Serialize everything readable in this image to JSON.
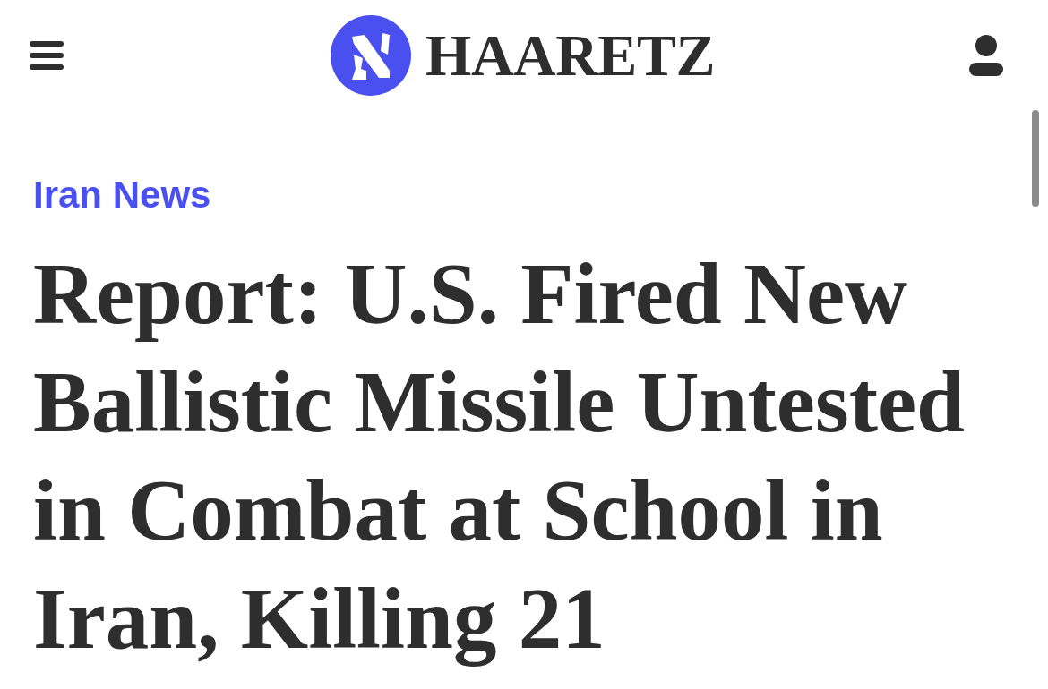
{
  "header": {
    "logo": {
      "wordmark": "HAARETZ"
    }
  },
  "article": {
    "section": "Iran News",
    "headline": "Report: U.S. Fired New Ballistic Missile Untested in Combat at School in Iran, Killing 21"
  }
}
